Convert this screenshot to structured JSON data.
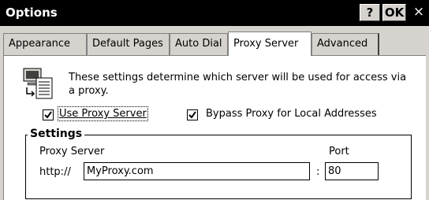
{
  "window": {
    "title": "Options",
    "help_label": "?",
    "ok_label": "OK",
    "close_label": "×"
  },
  "tabs": [
    {
      "label": "Appearance",
      "active": false
    },
    {
      "label": "Default Pages",
      "active": false
    },
    {
      "label": "Auto Dial",
      "active": false
    },
    {
      "label": "Proxy Server",
      "active": true
    },
    {
      "label": "Advanced",
      "active": false
    }
  ],
  "panel": {
    "icon": "network-settings-icon",
    "description": "These settings determine which server will be used for access via a proxy.",
    "use_proxy": {
      "label": "Use Proxy Server",
      "checked": true
    },
    "bypass_local": {
      "label": "Bypass Proxy for Local Addresses",
      "checked": true
    },
    "settings": {
      "title": "Settings",
      "proxy_server_label": "Proxy Server",
      "prefix": "http://",
      "proxy_value": "MyProxy.com",
      "separator": ":",
      "port_label": "Port",
      "port_value": "80"
    }
  }
}
